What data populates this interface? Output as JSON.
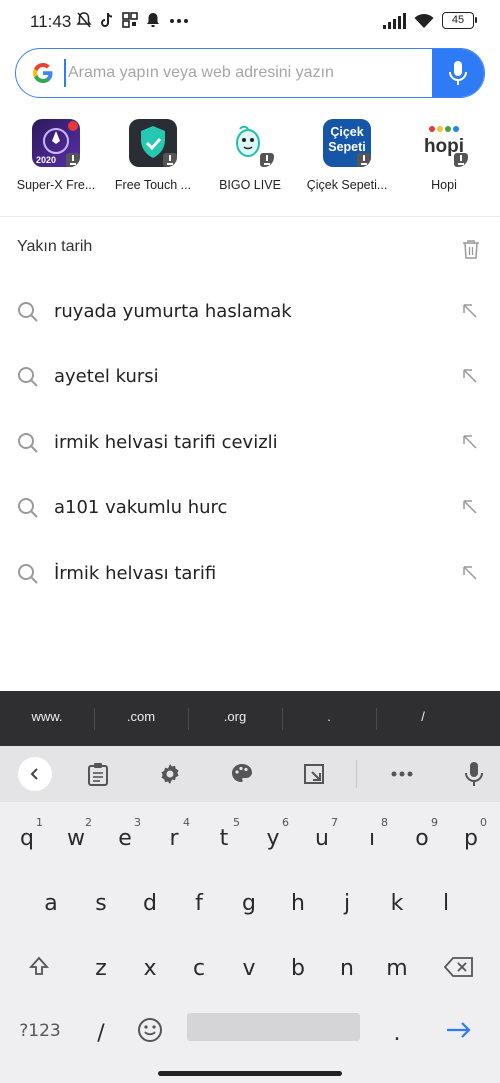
{
  "status_bar": {
    "time": "11:43",
    "battery": "45"
  },
  "search": {
    "placeholder": "Arama yapın veya web adresini yazın",
    "value": ""
  },
  "apps": [
    {
      "label": "Super-X Fre...",
      "icon": "super-x-icon"
    },
    {
      "label": "Free Touch ...",
      "icon": "free-touch-shield-icon"
    },
    {
      "label": "BIGO LIVE",
      "icon": "bigo-live-icon"
    },
    {
      "label": "Çiçek Sepeti...",
      "icon": "cicek-sepeti-icon",
      "icon_text": "Çiçek Sepeti"
    },
    {
      "label": "Hopi",
      "icon": "hopi-icon",
      "icon_text": "hopi"
    }
  ],
  "history": {
    "title": "Yakın tarih",
    "items": [
      "ruyada yumurta haslamak",
      "ayetel kursi",
      "irmik helvasi tarifi cevizli",
      "a101 vakumlu hurc",
      "İrmik helvası tarifi"
    ]
  },
  "keyboard": {
    "suggestions": [
      "www.",
      ".com",
      ".org",
      ".",
      "/"
    ],
    "row1": [
      {
        "k": "q",
        "s": "1"
      },
      {
        "k": "w",
        "s": "2"
      },
      {
        "k": "e",
        "s": "3"
      },
      {
        "k": "r",
        "s": "4"
      },
      {
        "k": "t",
        "s": "5"
      },
      {
        "k": "y",
        "s": "6"
      },
      {
        "k": "u",
        "s": "7"
      },
      {
        "k": "ı",
        "s": "8"
      },
      {
        "k": "o",
        "s": "9"
      },
      {
        "k": "p",
        "s": "0"
      }
    ],
    "row2": [
      "a",
      "s",
      "d",
      "f",
      "g",
      "h",
      "j",
      "k",
      "l"
    ],
    "row3": [
      "z",
      "x",
      "c",
      "v",
      "b",
      "n",
      "m"
    ],
    "symbols_label": "?123",
    "slash": "/",
    "period": ".",
    "accent_color": "#2f7bf5"
  }
}
